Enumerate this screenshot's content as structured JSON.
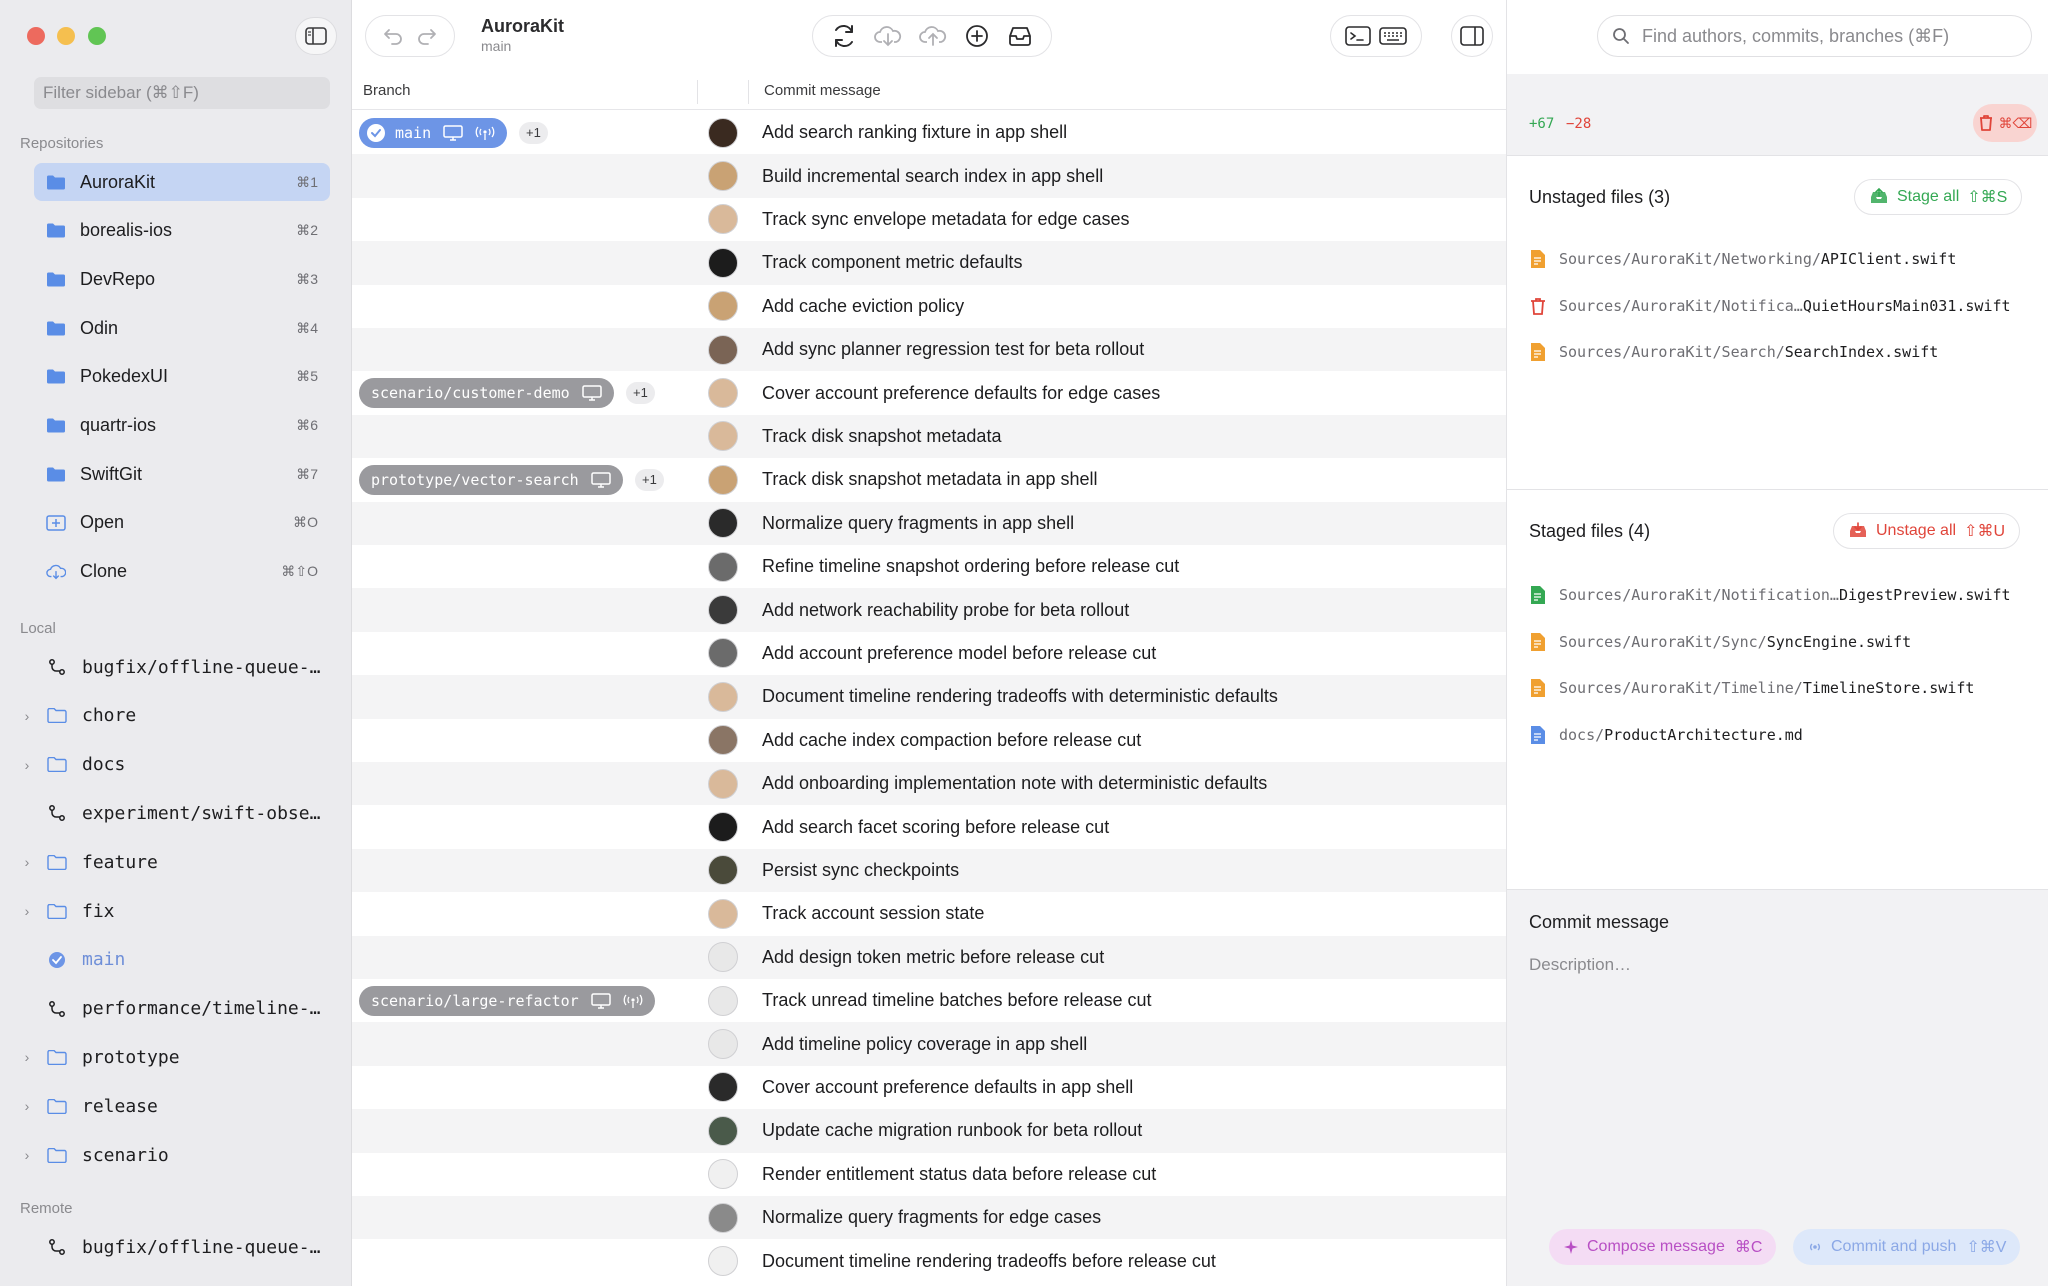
{
  "sidebar": {
    "filter_placeholder": "Filter sidebar (⌘⇧F)",
    "repositories_heading": "Repositories",
    "repos": [
      {
        "label": "AuroraKit",
        "kbd": "⌘1",
        "active": true
      },
      {
        "label": "borealis-ios",
        "kbd": "⌘2"
      },
      {
        "label": "DevRepo",
        "kbd": "⌘3"
      },
      {
        "label": "Odin",
        "kbd": "⌘4"
      },
      {
        "label": "PokedexUI",
        "kbd": "⌘5"
      },
      {
        "label": "quartr-ios",
        "kbd": "⌘6"
      },
      {
        "label": "SwiftGit",
        "kbd": "⌘7"
      },
      {
        "label": "Open",
        "kbd": "⌘O"
      },
      {
        "label": "Clone",
        "kbd": "⌘⇧O"
      }
    ],
    "local_heading": "Local",
    "local": [
      {
        "label": "bugfix/offline-queue-…",
        "type": "branch"
      },
      {
        "label": "chore",
        "type": "folder"
      },
      {
        "label": "docs",
        "type": "folder"
      },
      {
        "label": "experiment/swift-obse…",
        "type": "branch"
      },
      {
        "label": "feature",
        "type": "folder"
      },
      {
        "label": "fix",
        "type": "folder"
      },
      {
        "label": "main",
        "type": "current"
      },
      {
        "label": "performance/timeline-…",
        "type": "branch"
      },
      {
        "label": "prototype",
        "type": "folder"
      },
      {
        "label": "release",
        "type": "folder"
      },
      {
        "label": "scenario",
        "type": "folder"
      }
    ],
    "remote_heading": "Remote",
    "remote": [
      {
        "label": "bugfix/offline-queue-…"
      }
    ]
  },
  "toolbar": {
    "repo_name": "AuroraKit",
    "branch_name": "main"
  },
  "list": {
    "col_branch": "Branch",
    "col_message": "Commit message",
    "rows": [
      {
        "msg": "Add search ranking fixture in app shell",
        "avatar": "#3a2a20"
      },
      {
        "msg": "Build incremental search index in app shell",
        "avatar": "#c9a274"
      },
      {
        "msg": "Track sync envelope metadata for edge cases",
        "avatar": "#d9b99a"
      },
      {
        "msg": "Track component metric defaults",
        "avatar": "#1c1c1c"
      },
      {
        "msg": "Add cache eviction policy",
        "avatar": "#c9a274"
      },
      {
        "msg": "Add sync planner regression test for beta rollout",
        "avatar": "#7a6455"
      },
      {
        "msg": "Cover account preference defaults for edge cases",
        "avatar": "#d9b99a"
      },
      {
        "msg": "Track disk snapshot metadata",
        "avatar": "#d9b99a"
      },
      {
        "msg": "Track disk snapshot metadata in app shell",
        "avatar": "#c9a274"
      },
      {
        "msg": "Normalize query fragments in app shell",
        "avatar": "#2a2a2a"
      },
      {
        "msg": "Refine timeline snapshot ordering before release cut",
        "avatar": "#6b6b6b"
      },
      {
        "msg": "Add network reachability probe for beta rollout",
        "avatar": "#3a3a3a"
      },
      {
        "msg": "Add account preference model before release cut",
        "avatar": "#6b6b6b"
      },
      {
        "msg": "Document timeline rendering tradeoffs with deterministic defaults",
        "avatar": "#d9b99a"
      },
      {
        "msg": "Add cache index compaction before release cut",
        "avatar": "#8a7565"
      },
      {
        "msg": "Add onboarding implementation note with deterministic defaults",
        "avatar": "#d9b99a"
      },
      {
        "msg": "Add search facet scoring before release cut",
        "avatar": "#1c1c1c"
      },
      {
        "msg": "Persist sync checkpoints",
        "avatar": "#4a4a3a"
      },
      {
        "msg": "Track account session state",
        "avatar": "#d9b99a"
      },
      {
        "msg": "Add design token metric before release cut",
        "avatar": "#e8e8e8"
      },
      {
        "msg": "Track unread timeline batches before release cut",
        "avatar": "#e8e8e8"
      },
      {
        "msg": "Add timeline policy coverage in app shell",
        "avatar": "#e8e8e8"
      },
      {
        "msg": "Cover account preference defaults in app shell",
        "avatar": "#2a2a2a"
      },
      {
        "msg": "Update cache migration runbook for beta rollout",
        "avatar": "#4a5a4a"
      },
      {
        "msg": "Render entitlement status data before release cut",
        "avatar": "#f0f0f0"
      },
      {
        "msg": "Normalize query fragments for edge cases",
        "avatar": "#8a8a8a"
      },
      {
        "msg": "Document timeline rendering tradeoffs before release cut",
        "avatar": "#f0f0f0"
      }
    ],
    "tags": [
      {
        "row": 0,
        "label": "main",
        "extra": "+1",
        "current": true
      },
      {
        "row": 6,
        "label": "scenario/customer-demo",
        "extra": "+1"
      },
      {
        "row": 8,
        "label": "prototype/vector-search",
        "extra": "+1"
      },
      {
        "row": 20,
        "label": "scenario/large-refactor",
        "extra": ""
      }
    ]
  },
  "right": {
    "search_placeholder": "Find authors, commits, branches (⌘F)",
    "stat_add": "+67",
    "stat_del": "−28",
    "discard_kbd": "⌘⌫",
    "unstaged_title": "Unstaged files (3)",
    "stage_all": "Stage all",
    "stage_all_kbd": "⇧⌘S",
    "unstaged": [
      {
        "dir": "Sources/AuroraKit/Networking/",
        "name": "APIClient.swift",
        "kind": "modified"
      },
      {
        "dir": "Sources/AuroraKit/Notifica…",
        "name": "QuietHoursMain031.swift",
        "kind": "deleted"
      },
      {
        "dir": "Sources/AuroraKit/Search/",
        "name": "SearchIndex.swift",
        "kind": "modified"
      }
    ],
    "staged_title": "Staged files (4)",
    "unstage_all": "Unstage all",
    "unstage_all_kbd": "⇧⌘U",
    "staged": [
      {
        "dir": "Sources/AuroraKit/Notification…",
        "name": "DigestPreview.swift",
        "kind": "added"
      },
      {
        "dir": "Sources/AuroraKit/Sync/",
        "name": "SyncEngine.swift",
        "kind": "modified"
      },
      {
        "dir": "Sources/AuroraKit/Timeline/",
        "name": "TimelineStore.swift",
        "kind": "modified"
      },
      {
        "dir": "docs/",
        "name": "ProductArchitecture.md",
        "kind": "doc"
      }
    ],
    "commit_title": "Commit message",
    "commit_desc_placeholder": "Description…",
    "compose_label": "Compose message",
    "compose_kbd": "⌘C",
    "commit_push_label": "Commit and push",
    "commit_push_kbd": "⇧⌘V"
  },
  "colors": {
    "accent": "#6d95e6",
    "added": "#34a853",
    "deleted": "#e0453a",
    "compose": "#b84fc4"
  }
}
